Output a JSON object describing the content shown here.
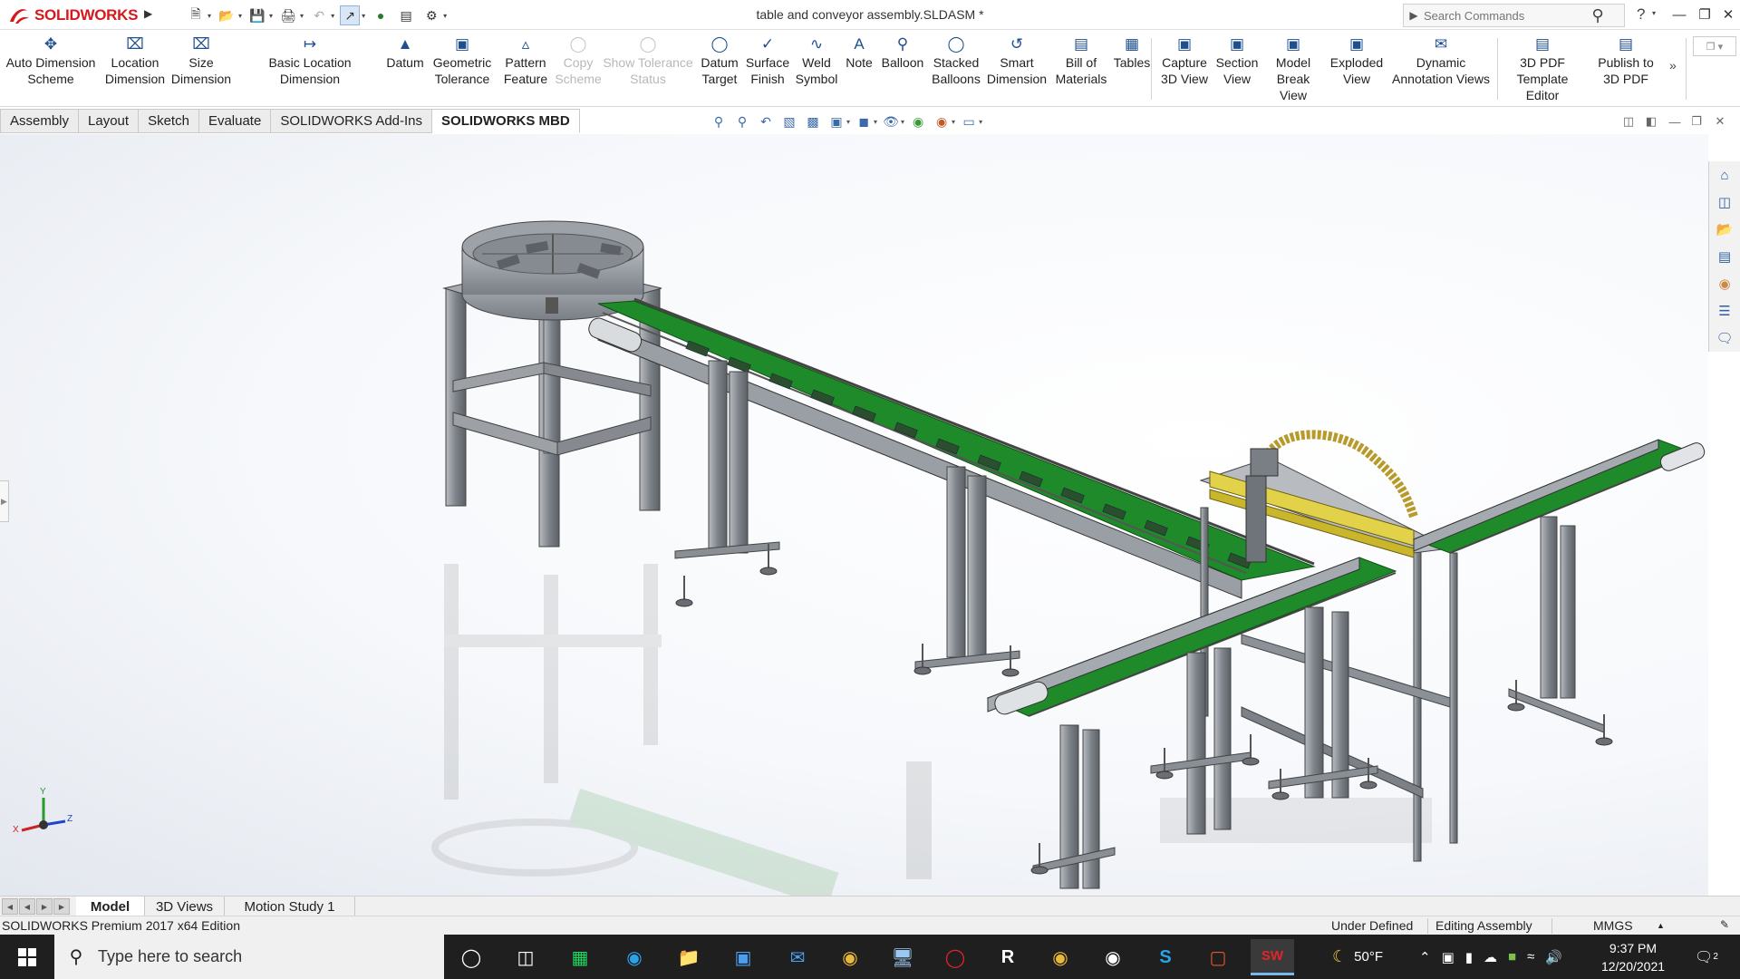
{
  "app": {
    "logo_text": "SOLIDWORKS",
    "document_title": "table and conveyor assembly.SLDASM *",
    "search_placeholder": "Search Commands",
    "help_glyph": "?"
  },
  "ribbon": {
    "buttons": [
      {
        "label1": "Auto Dimension",
        "label2": "Scheme",
        "icon": "auto-dimension-icon",
        "disabled": false
      },
      {
        "label1": "Location",
        "label2": "Dimension",
        "icon": "location-dimension-icon",
        "disabled": false
      },
      {
        "label1": "Size",
        "label2": "Dimension",
        "icon": "size-dimension-icon",
        "disabled": false
      },
      {
        "label1": "Basic Location Dimension",
        "label2": "",
        "icon": "basic-location-dimension-icon",
        "disabled": false
      },
      {
        "label1": "Datum",
        "label2": "",
        "icon": "datum-icon",
        "disabled": false
      },
      {
        "label1": "Geometric",
        "label2": "Tolerance",
        "icon": "geometric-tolerance-icon",
        "disabled": false
      },
      {
        "label1": "Pattern",
        "label2": "Feature",
        "icon": "pattern-feature-icon",
        "disabled": false
      },
      {
        "label1": "Copy",
        "label2": "Scheme",
        "icon": "copy-scheme-icon",
        "disabled": true
      },
      {
        "label1": "Show Tolerance",
        "label2": "Status",
        "icon": "show-tolerance-status-icon",
        "disabled": true
      },
      {
        "label1": "Datum",
        "label2": "Target",
        "icon": "datum-target-icon",
        "disabled": false
      },
      {
        "label1": "Surface",
        "label2": "Finish",
        "icon": "surface-finish-icon",
        "disabled": false
      },
      {
        "label1": "Weld",
        "label2": "Symbol",
        "icon": "weld-symbol-icon",
        "disabled": false
      },
      {
        "label1": "Note",
        "label2": "",
        "icon": "note-icon",
        "disabled": false
      },
      {
        "label1": "Balloon",
        "label2": "",
        "icon": "balloon-icon",
        "disabled": false
      },
      {
        "label1": "Stacked",
        "label2": "Balloons",
        "icon": "stacked-balloons-icon",
        "disabled": false
      },
      {
        "label1": "Smart",
        "label2": "Dimension",
        "icon": "smart-dimension-icon",
        "disabled": false
      },
      {
        "label1": "Bill of",
        "label2": "Materials",
        "icon": "bill-of-materials-icon",
        "disabled": false
      },
      {
        "label1": "Tables",
        "label2": "",
        "icon": "tables-icon",
        "disabled": false
      },
      {
        "label1": "Capture",
        "label2": "3D View",
        "icon": "capture-3d-view-icon",
        "disabled": false
      },
      {
        "label1": "Section",
        "label2": "View",
        "icon": "section-view-icon",
        "disabled": false
      },
      {
        "label1": "Model",
        "label2": "Break View",
        "icon": "model-break-view-icon",
        "disabled": false
      },
      {
        "label1": "Exploded",
        "label2": "View",
        "icon": "exploded-view-icon",
        "disabled": false
      },
      {
        "label1": "Dynamic",
        "label2": "Annotation Views",
        "icon": "dynamic-annotation-views-icon",
        "disabled": false
      },
      {
        "label1": "3D PDF",
        "label2": "Template Editor",
        "icon": "3d-pdf-template-editor-icon",
        "disabled": false
      },
      {
        "label1": "Publish to",
        "label2": "3D PDF",
        "icon": "publish-3d-pdf-icon",
        "disabled": false
      }
    ]
  },
  "tabs": [
    {
      "label": "Assembly",
      "active": false
    },
    {
      "label": "Layout",
      "active": false
    },
    {
      "label": "Sketch",
      "active": false
    },
    {
      "label": "Evaluate",
      "active": false
    },
    {
      "label": "SOLIDWORKS Add-Ins",
      "active": false
    },
    {
      "label": "SOLIDWORKS MBD",
      "active": true
    }
  ],
  "triad": {
    "x": "X",
    "y": "Y",
    "z": "Z"
  },
  "bottom_tabs": [
    {
      "label": "Model",
      "active": true
    },
    {
      "label": "3D Views",
      "active": false
    },
    {
      "label": "Motion Study 1",
      "active": false
    }
  ],
  "status": {
    "edition": "SOLIDWORKS Premium 2017 x64 Edition",
    "definition": "Under Defined",
    "mode": "Editing Assembly",
    "units": "MMGS"
  },
  "taskbar": {
    "search_text": "Type here to search",
    "weather": "50°F",
    "time": "9:37 PM",
    "date": "12/20/2021",
    "notifications": "2"
  },
  "colors": {
    "brand_red": "#d7191d",
    "belt_green": "#1f8a2a",
    "frame_gray": "#8f949a",
    "guard_yellow": "#c9b62a"
  }
}
